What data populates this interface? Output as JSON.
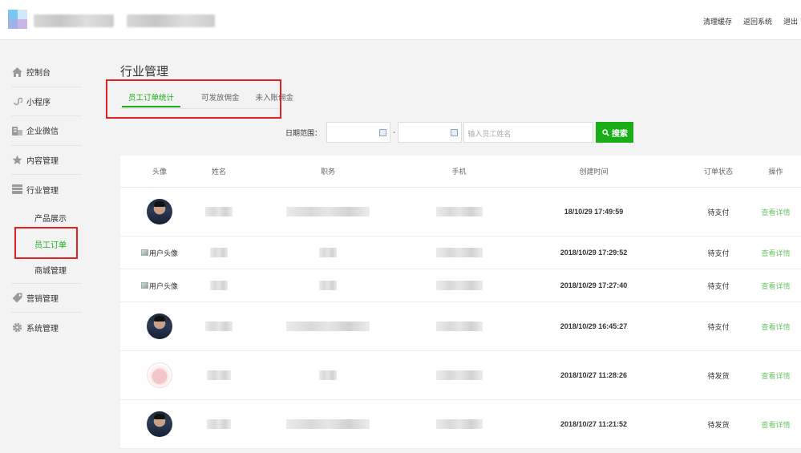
{
  "top_links": [
    "清理缓存",
    "返回系统",
    "退出"
  ],
  "sidebar": {
    "items": [
      {
        "label": "控制台",
        "icon": "home-icon"
      },
      {
        "label": "小程序",
        "icon": "mini-program-icon"
      },
      {
        "label": "企业微信",
        "icon": "building-icon"
      },
      {
        "label": "内容管理",
        "icon": "star-icon"
      },
      {
        "label": "行业管理",
        "icon": "layers-icon"
      }
    ],
    "sub_items": [
      "产品展示",
      "员工订单",
      "商城管理"
    ],
    "items_after": [
      {
        "label": "营销管理",
        "icon": "tag-icon"
      },
      {
        "label": "系统管理",
        "icon": "gear-icon"
      }
    ]
  },
  "main": {
    "title": "行业管理",
    "tabs": [
      "员工订单统计",
      "可发放佣金",
      "未入账佣金"
    ],
    "filter": {
      "date_label": "日期范围：",
      "name_placeholder": "输入员工姓名",
      "search_label": "搜索"
    },
    "table": {
      "headers": [
        "头像",
        "姓名",
        "职务",
        "手机",
        "创建时间",
        "订单状态",
        "操作"
      ],
      "rows": [
        {
          "avatar": "photo",
          "time": "18/10/29 17:49:59",
          "status": "待支付",
          "action": "查看详情"
        },
        {
          "avatar": "alt",
          "avatar_alt": "用户头像",
          "time": "2018/10/29 17:29:52",
          "status": "待支付",
          "action": "查看详情"
        },
        {
          "avatar": "alt",
          "avatar_alt": "用户头像",
          "time": "2018/10/29 17:27:40",
          "status": "待支付",
          "action": "查看详情"
        },
        {
          "avatar": "photo",
          "time": "2018/10/29 16:45:27",
          "status": "待支付",
          "action": "查看详情"
        },
        {
          "avatar": "cake",
          "time": "2018/10/27 11:28:26",
          "status": "待发货",
          "action": "查看详情"
        },
        {
          "avatar": "photo",
          "time": "2018/10/27 11:21:52",
          "status": "待发货",
          "action": "查看详情"
        }
      ]
    }
  },
  "colors": {
    "accent": "#1aad19",
    "highlight": "#e02424"
  }
}
